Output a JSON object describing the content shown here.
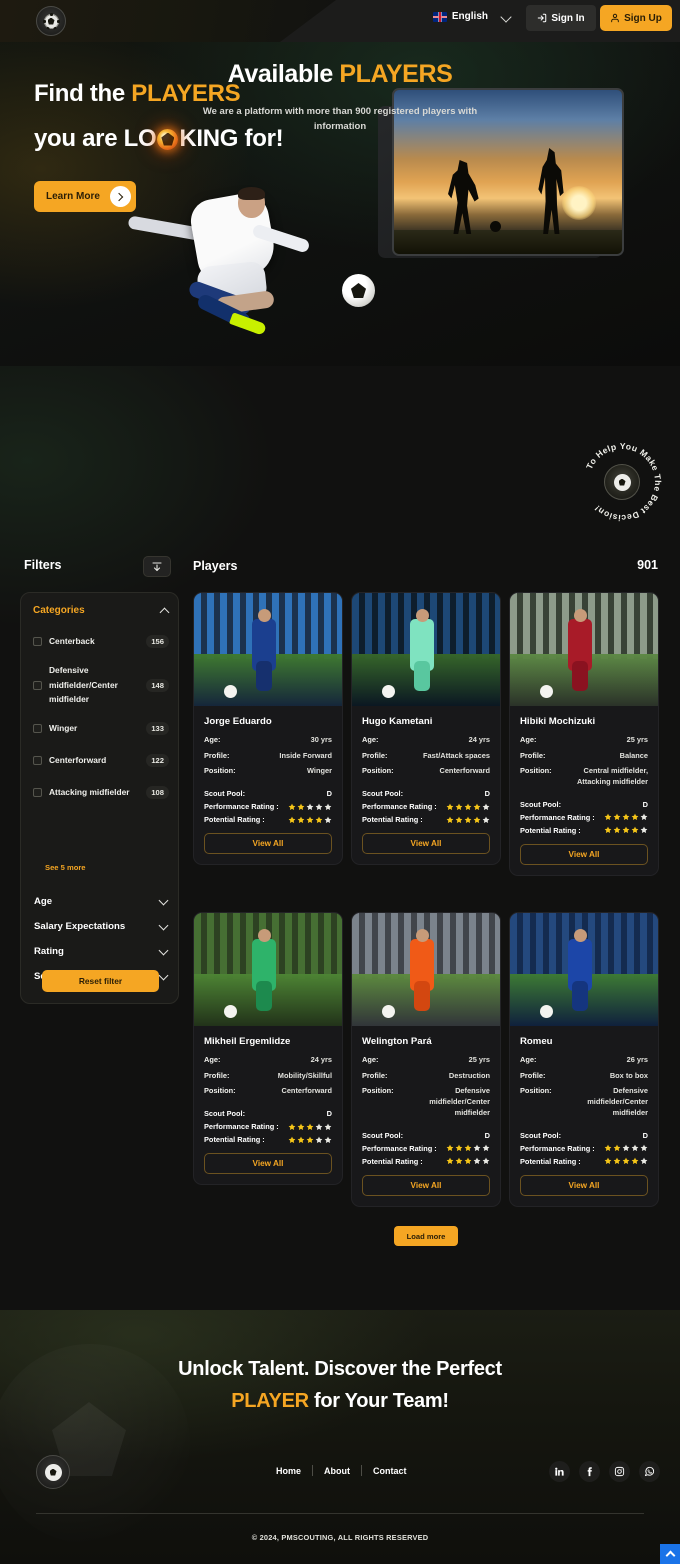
{
  "header": {
    "logo_alt": "PMScouting logo",
    "language": "English",
    "sign_in": "Sign In",
    "sign_up": "Sign Up"
  },
  "hero": {
    "title_line1_plain": "Find the ",
    "title_line1_accent": "PLAYERS",
    "title_line2_a": "you are LO",
    "title_line2_b": "KING for!",
    "cta": "Learn More"
  },
  "available": {
    "title_plain": "Available ",
    "title_accent": "PLAYERS",
    "subtitle": "We are a platform with more than 900 registered players with information",
    "badge_text": "To Help You Make The Best Decision!"
  },
  "filters": {
    "label": "Filters",
    "categories_title": "Categories",
    "categories": [
      {
        "label": "Centerback",
        "count": "156"
      },
      {
        "label": "Defensive midfielder/Center midfielder",
        "count": "148"
      },
      {
        "label": "Winger",
        "count": "133"
      },
      {
        "label": "Centerforward",
        "count": "122"
      },
      {
        "label": "Attacking midfielder",
        "count": "108"
      }
    ],
    "see_more": "See 5 more",
    "accordions": [
      {
        "label": "Age"
      },
      {
        "label": "Salary Expectations"
      },
      {
        "label": "Rating"
      },
      {
        "label": "Scouts Pool"
      }
    ],
    "reset": "Reset filter"
  },
  "players_section": {
    "label": "Players",
    "count": "901",
    "load_more": "Load more",
    "field_labels": {
      "age": "Age:",
      "profile": "Profile:",
      "position": "Position:",
      "scout_pool": "Scout Pool:",
      "performance": "Performance Rating :",
      "potential": "Potential Rating :"
    },
    "view_all": "View All",
    "players": [
      {
        "name": "Jorge Eduardo",
        "age": "30 yrs",
        "profile": "Inside Forward",
        "position": "Winger",
        "scout_pool": "D",
        "performance_stars": 2,
        "potential_stars": 4
      },
      {
        "name": "Hugo Kametani",
        "age": "24 yrs",
        "profile": "Fast/Attack spaces",
        "position": "Centerforward",
        "scout_pool": "D",
        "performance_stars": 4,
        "potential_stars": 4
      },
      {
        "name": "Hibiki Mochizuki",
        "age": "25 yrs",
        "profile": "Balance",
        "position": "Central midfielder, Attacking midfielder",
        "scout_pool": "D",
        "performance_stars": 4,
        "potential_stars": 4
      },
      {
        "name": "Mikheil Ergemlidze",
        "age": "24 yrs",
        "profile": "Mobility/Skillful",
        "position": "Centerforward",
        "scout_pool": "D",
        "performance_stars": 3,
        "potential_stars": 3
      },
      {
        "name": "Welington Pará",
        "age": "25 yrs",
        "profile": "Destruction",
        "position": "Defensive midfielder/Center midfielder",
        "scout_pool": "D",
        "performance_stars": 3,
        "potential_stars": 3
      },
      {
        "name": "Romeu",
        "age": "26 yrs",
        "profile": "Box to box",
        "position": "Defensive midfielder/Center midfielder",
        "scout_pool": "D",
        "performance_stars": 2,
        "potential_stars": 4
      }
    ]
  },
  "cta": {
    "line1": "Unlock Talent. Discover the Perfect",
    "line2_accent": "PLAYER",
    "line2_rest": " for Your Team!"
  },
  "footer": {
    "nav": [
      "Home",
      "About",
      "Contact"
    ],
    "socials": [
      "linkedin-icon",
      "facebook-icon",
      "instagram-icon",
      "whatsapp-icon"
    ],
    "copyright": "© 2024, PMSCOUTING, ALL RIGHTS RESERVED"
  },
  "colors": {
    "accent": "#f5a623",
    "star_on": "#f5c518",
    "star_off": "#e9e9e4",
    "background": "#0d0d0c",
    "scroll_top": "#1a73e8"
  }
}
